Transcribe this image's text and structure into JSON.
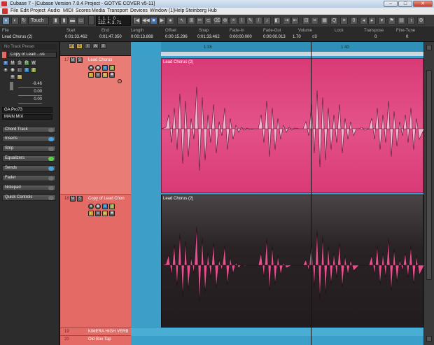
{
  "window": {
    "title": "Cubase 7 - [Cubase Version 7.0.4 Project - GOTYE COVER v5-11]"
  },
  "menu": [
    "File",
    "Edit",
    "Project",
    "Audio",
    "MIDI",
    "Scores",
    "Media",
    "Transport",
    "Devices",
    "Window (1)",
    "Help",
    "Steinberg Hub"
  ],
  "toolbar": {
    "automation_mode": "Touch",
    "position_display": "1. 1. 1.  0\n122. 4. 3. 71"
  },
  "infoline": {
    "headers": [
      "File",
      "Start",
      "End",
      "Length",
      "Offset",
      "Snap",
      "Fade-In",
      "Fade-Out",
      "Volume",
      "Lock",
      "Transpose",
      "Fine-Tune"
    ],
    "values": [
      "Lead Chorus (2)",
      "0:01:33.462",
      "0:01:47.350",
      "0:00:13.888",
      "0:00:15.296",
      "0:01:33.462",
      "0:00:00.000",
      "0:00:00.013",
      "1.70",
      "",
      "0",
      "0"
    ],
    "volume_unit": "dB"
  },
  "inspector": {
    "preset": "No Track Preset",
    "track_name": "Copy of Lead ...us",
    "volume_value": "-9.46",
    "pan_value": "0.00",
    "delay_value": "0.00",
    "input": "GA Pro73",
    "output": "MAIN MIX",
    "sections": [
      "Chord Track",
      "Inserts",
      "Strip",
      "Equalizers",
      "Sends",
      "Fader",
      "Notepad",
      "Quick Controls"
    ]
  },
  "tracks": [
    {
      "number": "17",
      "name": "Lead Chorus",
      "event": "Lead Chorus (2)",
      "selected": true
    },
    {
      "number": "18",
      "name": "Copy of Lead Chon",
      "event": "Lead Chorus (2)",
      "selected": false
    },
    {
      "number": "19",
      "name": "KIMERA HIGH VERB",
      "event": "",
      "selected": false
    },
    {
      "number": "20",
      "name": "Old Box Tap",
      "event": "",
      "selected": false
    }
  ],
  "ruler": {
    "marks": [
      "1:35",
      "1:40"
    ]
  },
  "colors": {
    "selected_event": "#e0447f",
    "waveform_selected": "#f2b6cf",
    "event_dark": "#2c2426",
    "waveform_pink": "#e84f8f",
    "project_bg": "#3aa0c9",
    "track_color": "#e46a66"
  }
}
